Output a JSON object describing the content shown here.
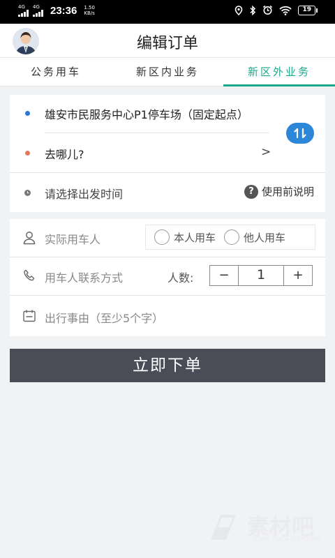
{
  "status_bar": {
    "network1": "4G",
    "network2": "4G",
    "time": "23:36",
    "speed_value": "1.50",
    "speed_unit": "KB/s",
    "battery": "19"
  },
  "header": {
    "title": "编辑订单"
  },
  "tabs": [
    {
      "label": "公务用车",
      "active": false
    },
    {
      "label": "新区内业务",
      "active": false
    },
    {
      "label": "新区外业务",
      "active": true
    }
  ],
  "route": {
    "origin": "雄安市民服务中心P1停车场（固定起点）",
    "destination_placeholder": "去哪儿?",
    "destination_arrow": ">",
    "time_placeholder": "请选择出发时间",
    "help_label": "使用前说明",
    "help_icon": "question-icon",
    "swap_icon": "swap-icon"
  },
  "passenger": {
    "actual_user_placeholder": "实际用车人",
    "options": [
      "本人用车",
      "他人用车"
    ],
    "contact_placeholder": "用车人联系方式",
    "count_label": "人数:",
    "count_value": "1",
    "minus": "−",
    "plus": "+",
    "reason_placeholder": "出行事由（至少5个字）"
  },
  "submit_label": "立即下单",
  "watermark": {
    "text": "素材吧",
    "url": "www.sucaibar.com"
  },
  "colors": {
    "accent": "#1aa88b",
    "swap_button": "#2c87d9",
    "origin_dot": "#2c73d9",
    "destination_dot": "#e07a5f",
    "submit_bg": "#4a4c57"
  }
}
